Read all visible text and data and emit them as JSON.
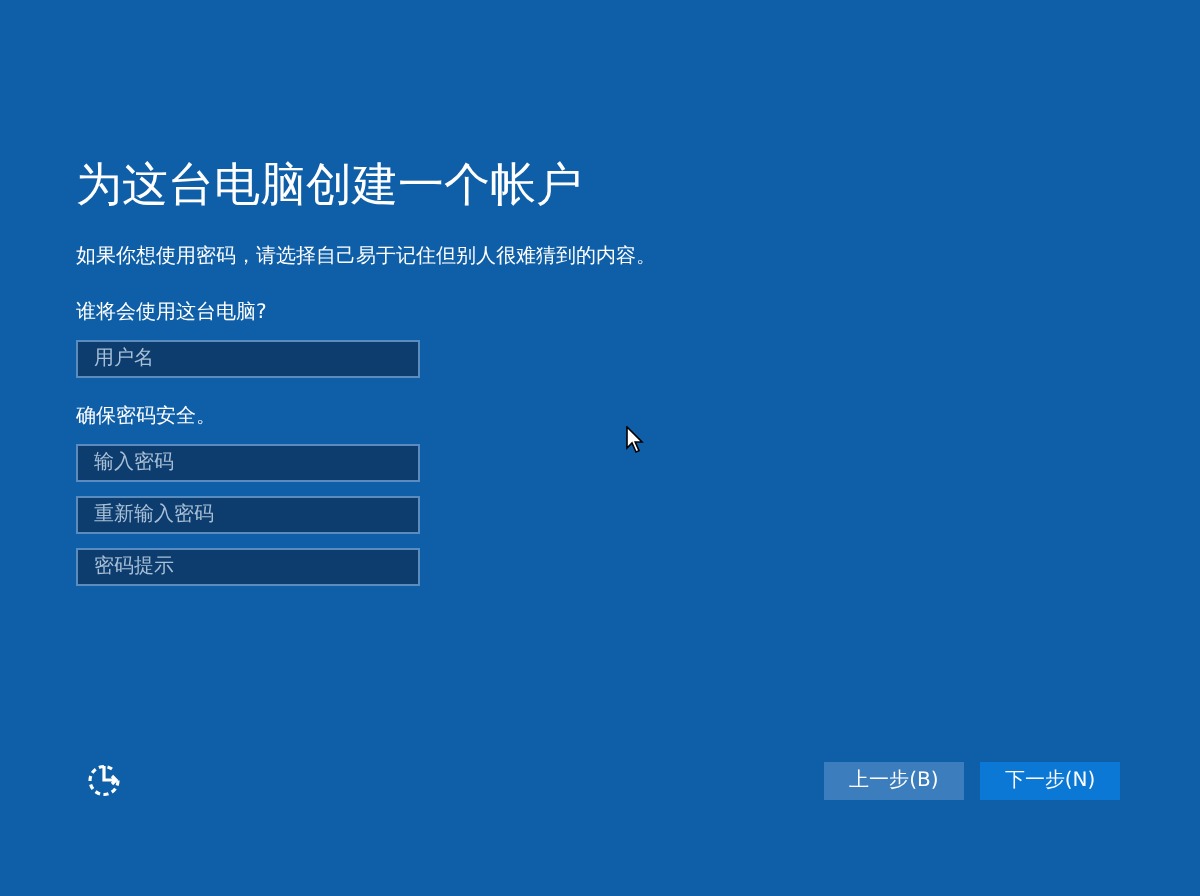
{
  "title": "为这台电脑创建一个帐户",
  "description": "如果你想使用密码，请选择自己易于记住但别人很难猜到的内容。",
  "sections": [
    {
      "label": "谁将会使用这台电脑?",
      "fields": [
        {
          "placeholder": "用户名"
        }
      ]
    },
    {
      "label": "确保密码安全。",
      "fields": [
        {
          "placeholder": "输入密码"
        },
        {
          "placeholder": "重新输入密码"
        },
        {
          "placeholder": "密码提示"
        }
      ]
    }
  ],
  "buttons": [
    {
      "label": "上一步(B)",
      "kind": "secondary"
    },
    {
      "label": "下一步(N)",
      "kind": "primary"
    }
  ]
}
